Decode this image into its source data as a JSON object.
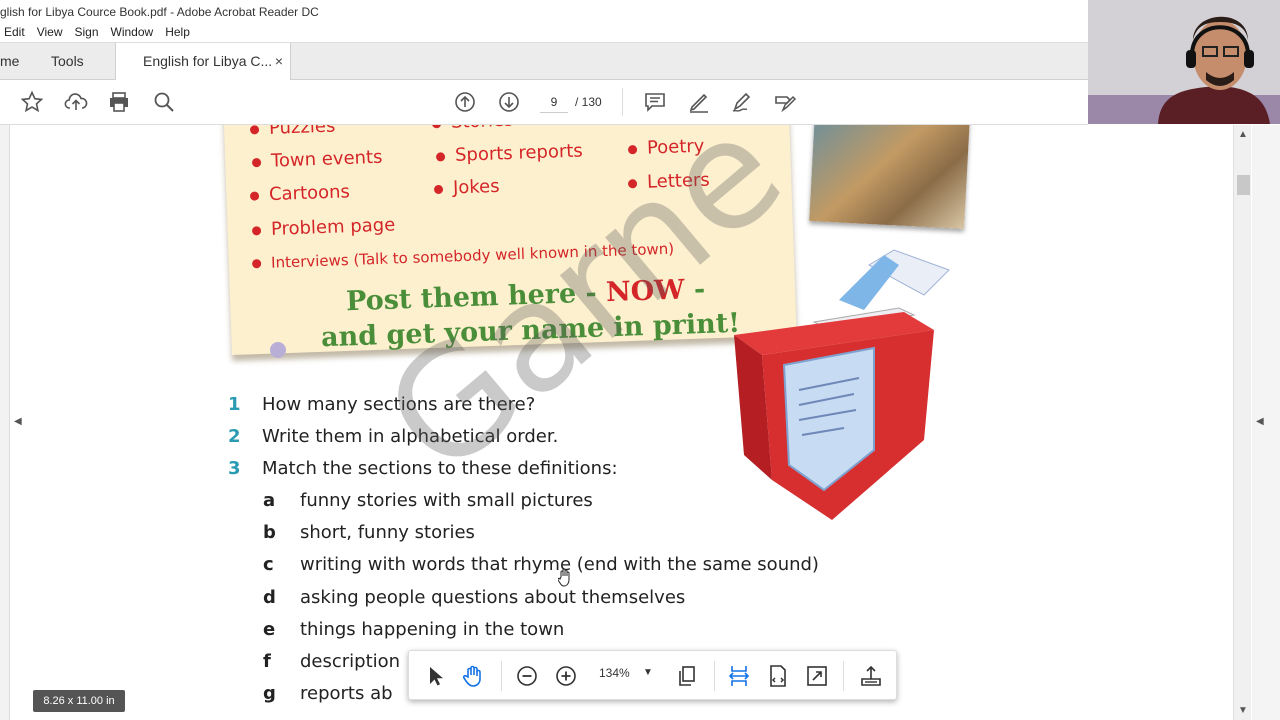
{
  "window": {
    "title": "glish for Libya Cource Book.pdf - Adobe Acrobat Reader DC"
  },
  "menu": [
    "Edit",
    "View",
    "Sign",
    "Window",
    "Help"
  ],
  "tabs": {
    "home": "me",
    "tools": "Tools",
    "document": "English for Libya C...",
    "close": "×"
  },
  "toolbar": {
    "page_current": "9",
    "page_total": "/ 130"
  },
  "page": {
    "board_items": [
      {
        "label": "Puzzles"
      },
      {
        "label": "Stories"
      },
      {
        "label": "Town events"
      },
      {
        "label": "Sports reports"
      },
      {
        "label": "Poetry"
      },
      {
        "label": "Cartoons"
      },
      {
        "label": "Jokes"
      },
      {
        "label": "Letters"
      },
      {
        "label": "Problem page"
      },
      {
        "label": "Interviews (Talk to somebody well known in the town)"
      }
    ],
    "post_line1_a": "Post them here - ",
    "post_line1_now": "NOW",
    "post_line1_b": " -",
    "post_line2": "and get your name in print!",
    "questions": [
      {
        "num": "1",
        "text": "How many sections are there?"
      },
      {
        "num": "2",
        "text": "Write them in alphabetical order."
      },
      {
        "num": "3",
        "text": "Match the sections to these definitions:"
      }
    ],
    "definitions": [
      {
        "letter": "a",
        "text": "funny stories with small pictures"
      },
      {
        "letter": "b",
        "text": "short, funny stories"
      },
      {
        "letter": "c",
        "text": "writing with words that rhyme (end with the same sound)"
      },
      {
        "letter": "d",
        "text": "asking people questions about themselves"
      },
      {
        "letter": "e",
        "text": "things happening in the town"
      },
      {
        "letter": "f",
        "text": "description"
      },
      {
        "letter": "g",
        "text": "reports ab"
      }
    ],
    "watermark": "Garne"
  },
  "floating_toolbar": {
    "zoom": "134%"
  },
  "page_size": "8.26 x 11.00 in",
  "colors": {
    "board_red": "#d42528",
    "board_green": "#4a8e3a",
    "question_teal": "#2a9bb3",
    "acrobat_blue": "#1473e6"
  }
}
